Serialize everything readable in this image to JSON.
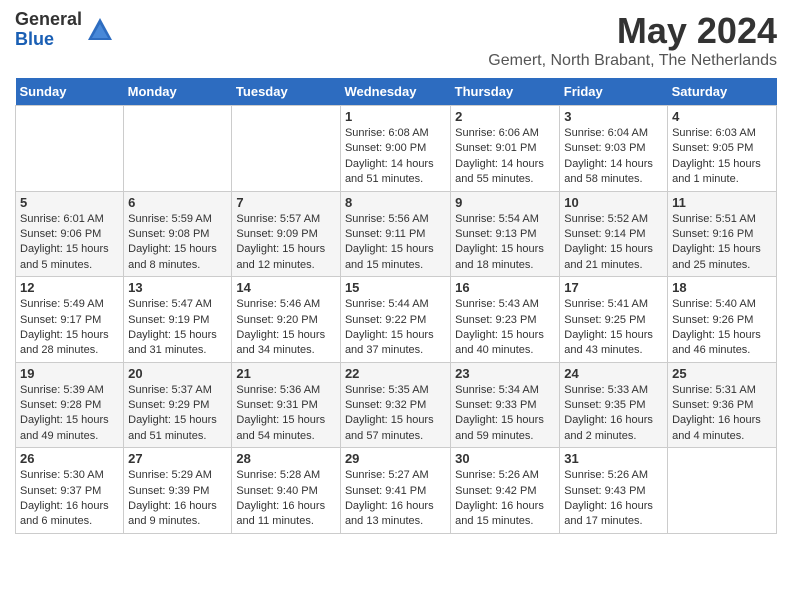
{
  "logo": {
    "general": "General",
    "blue": "Blue"
  },
  "title": {
    "month_year": "May 2024",
    "location": "Gemert, North Brabant, The Netherlands"
  },
  "days_of_week": [
    "Sunday",
    "Monday",
    "Tuesday",
    "Wednesday",
    "Thursday",
    "Friday",
    "Saturday"
  ],
  "weeks": [
    [
      {
        "day": "",
        "details": ""
      },
      {
        "day": "",
        "details": ""
      },
      {
        "day": "",
        "details": ""
      },
      {
        "day": "1",
        "details": "Sunrise: 6:08 AM\nSunset: 9:00 PM\nDaylight: 14 hours\nand 51 minutes."
      },
      {
        "day": "2",
        "details": "Sunrise: 6:06 AM\nSunset: 9:01 PM\nDaylight: 14 hours\nand 55 minutes."
      },
      {
        "day": "3",
        "details": "Sunrise: 6:04 AM\nSunset: 9:03 PM\nDaylight: 14 hours\nand 58 minutes."
      },
      {
        "day": "4",
        "details": "Sunrise: 6:03 AM\nSunset: 9:05 PM\nDaylight: 15 hours\nand 1 minute."
      }
    ],
    [
      {
        "day": "5",
        "details": "Sunrise: 6:01 AM\nSunset: 9:06 PM\nDaylight: 15 hours\nand 5 minutes."
      },
      {
        "day": "6",
        "details": "Sunrise: 5:59 AM\nSunset: 9:08 PM\nDaylight: 15 hours\nand 8 minutes."
      },
      {
        "day": "7",
        "details": "Sunrise: 5:57 AM\nSunset: 9:09 PM\nDaylight: 15 hours\nand 12 minutes."
      },
      {
        "day": "8",
        "details": "Sunrise: 5:56 AM\nSunset: 9:11 PM\nDaylight: 15 hours\nand 15 minutes."
      },
      {
        "day": "9",
        "details": "Sunrise: 5:54 AM\nSunset: 9:13 PM\nDaylight: 15 hours\nand 18 minutes."
      },
      {
        "day": "10",
        "details": "Sunrise: 5:52 AM\nSunset: 9:14 PM\nDaylight: 15 hours\nand 21 minutes."
      },
      {
        "day": "11",
        "details": "Sunrise: 5:51 AM\nSunset: 9:16 PM\nDaylight: 15 hours\nand 25 minutes."
      }
    ],
    [
      {
        "day": "12",
        "details": "Sunrise: 5:49 AM\nSunset: 9:17 PM\nDaylight: 15 hours\nand 28 minutes."
      },
      {
        "day": "13",
        "details": "Sunrise: 5:47 AM\nSunset: 9:19 PM\nDaylight: 15 hours\nand 31 minutes."
      },
      {
        "day": "14",
        "details": "Sunrise: 5:46 AM\nSunset: 9:20 PM\nDaylight: 15 hours\nand 34 minutes."
      },
      {
        "day": "15",
        "details": "Sunrise: 5:44 AM\nSunset: 9:22 PM\nDaylight: 15 hours\nand 37 minutes."
      },
      {
        "day": "16",
        "details": "Sunrise: 5:43 AM\nSunset: 9:23 PM\nDaylight: 15 hours\nand 40 minutes."
      },
      {
        "day": "17",
        "details": "Sunrise: 5:41 AM\nSunset: 9:25 PM\nDaylight: 15 hours\nand 43 minutes."
      },
      {
        "day": "18",
        "details": "Sunrise: 5:40 AM\nSunset: 9:26 PM\nDaylight: 15 hours\nand 46 minutes."
      }
    ],
    [
      {
        "day": "19",
        "details": "Sunrise: 5:39 AM\nSunset: 9:28 PM\nDaylight: 15 hours\nand 49 minutes."
      },
      {
        "day": "20",
        "details": "Sunrise: 5:37 AM\nSunset: 9:29 PM\nDaylight: 15 hours\nand 51 minutes."
      },
      {
        "day": "21",
        "details": "Sunrise: 5:36 AM\nSunset: 9:31 PM\nDaylight: 15 hours\nand 54 minutes."
      },
      {
        "day": "22",
        "details": "Sunrise: 5:35 AM\nSunset: 9:32 PM\nDaylight: 15 hours\nand 57 minutes."
      },
      {
        "day": "23",
        "details": "Sunrise: 5:34 AM\nSunset: 9:33 PM\nDaylight: 15 hours\nand 59 minutes."
      },
      {
        "day": "24",
        "details": "Sunrise: 5:33 AM\nSunset: 9:35 PM\nDaylight: 16 hours\nand 2 minutes."
      },
      {
        "day": "25",
        "details": "Sunrise: 5:31 AM\nSunset: 9:36 PM\nDaylight: 16 hours\nand 4 minutes."
      }
    ],
    [
      {
        "day": "26",
        "details": "Sunrise: 5:30 AM\nSunset: 9:37 PM\nDaylight: 16 hours\nand 6 minutes."
      },
      {
        "day": "27",
        "details": "Sunrise: 5:29 AM\nSunset: 9:39 PM\nDaylight: 16 hours\nand 9 minutes."
      },
      {
        "day": "28",
        "details": "Sunrise: 5:28 AM\nSunset: 9:40 PM\nDaylight: 16 hours\nand 11 minutes."
      },
      {
        "day": "29",
        "details": "Sunrise: 5:27 AM\nSunset: 9:41 PM\nDaylight: 16 hours\nand 13 minutes."
      },
      {
        "day": "30",
        "details": "Sunrise: 5:26 AM\nSunset: 9:42 PM\nDaylight: 16 hours\nand 15 minutes."
      },
      {
        "day": "31",
        "details": "Sunrise: 5:26 AM\nSunset: 9:43 PM\nDaylight: 16 hours\nand 17 minutes."
      },
      {
        "day": "",
        "details": ""
      }
    ]
  ]
}
